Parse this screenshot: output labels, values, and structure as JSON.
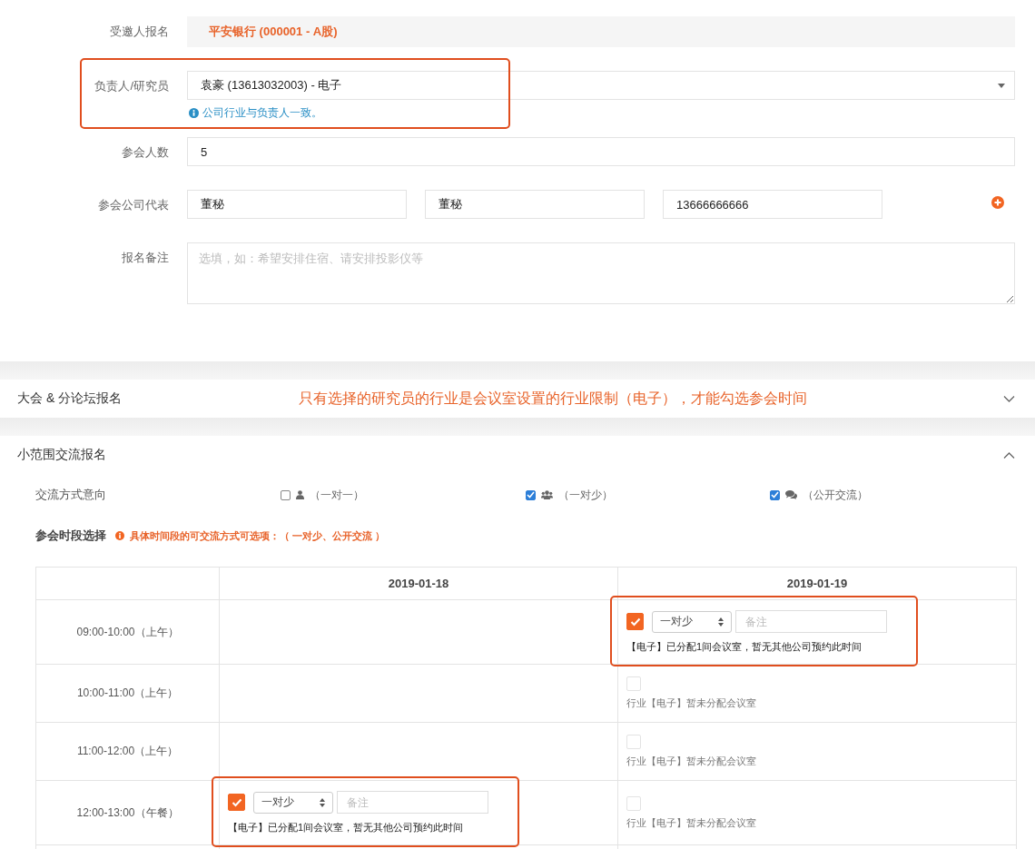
{
  "form": {
    "invitee": {
      "label": "受邀人报名",
      "value": "平安银行 (000001 - A股)"
    },
    "researcher": {
      "label": "负责人/研究员",
      "value": "袁豪 (13613032003) - 电子",
      "hint": "公司行业与负责人一致。",
      "highlighted": true
    },
    "attendees": {
      "label": "参会人数",
      "value": "5"
    },
    "representatives": {
      "label": "参会公司代表",
      "values": [
        "董秘",
        "董秘",
        "13666666666"
      ]
    },
    "remarks": {
      "label": "报名备注",
      "placeholder": "选填，如：希望安排住宿、请安排投影仪等"
    }
  },
  "sections": [
    {
      "title": "大会 & 分论坛报名",
      "expanded": false,
      "annotation": "只有选择的研究员的行业是会议室设置的行业限制（电子），才能勾选参会时间"
    },
    {
      "title": "小范围交流报名",
      "expanded": true
    }
  ],
  "exchange": {
    "label": "交流方式意向",
    "options": [
      {
        "kind": "person",
        "label": "（一对一）",
        "checked": false
      },
      {
        "kind": "group",
        "label": "（一对少）",
        "checked": true
      },
      {
        "kind": "chat",
        "label": "（公开交流）",
        "checked": true
      }
    ]
  },
  "slots": {
    "label": "参会时段选择",
    "hint": "具体时间段的可交流方式可选项：（ 一对少、公开交流 ）"
  },
  "table": {
    "columns": [
      "2019-01-18",
      "2019-01-19"
    ],
    "rows": [
      {
        "time": "09:00-10:00（上午）",
        "cells": [
          {
            "kind": "empty"
          },
          {
            "kind": "booking",
            "checked": true,
            "mode": "一对少",
            "placeholder": "备注",
            "note": "【电子】已分配1间会议室，暂无其他公司预约此时间",
            "highlighted": true
          }
        ]
      },
      {
        "time": "10:00-11:00（上午）",
        "cells": [
          {
            "kind": "empty"
          },
          {
            "kind": "unavailable",
            "checked": false,
            "note": "行业【电子】暂未分配会议室"
          }
        ]
      },
      {
        "time": "11:00-12:00（上午）",
        "cells": [
          {
            "kind": "empty"
          },
          {
            "kind": "unavailable",
            "checked": false,
            "note": "行业【电子】暂未分配会议室"
          }
        ]
      },
      {
        "time": "12:00-13:00（午餐）",
        "cells": [
          {
            "kind": "booking",
            "checked": true,
            "mode": "一对少",
            "placeholder": "备注",
            "note": "【电子】已分配1间会议室，暂无其他公司预约此时间",
            "highlighted": true
          },
          {
            "kind": "unavailable",
            "checked": false,
            "note": "行业【电子】暂未分配会议室"
          }
        ]
      }
    ]
  }
}
